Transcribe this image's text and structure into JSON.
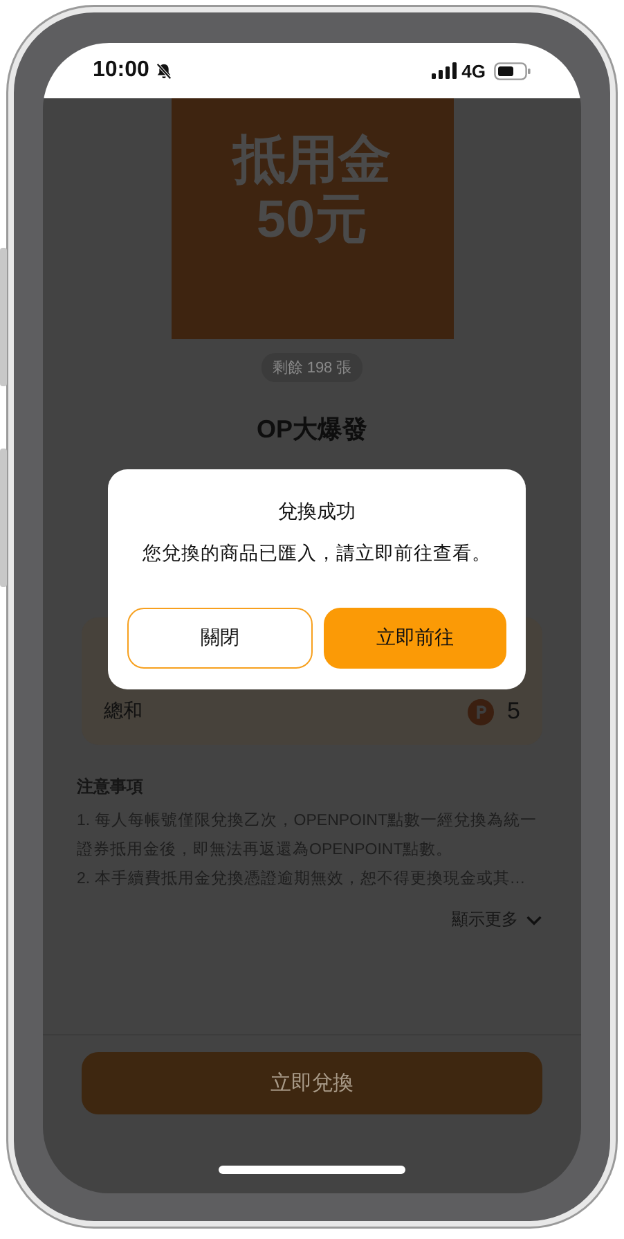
{
  "status_bar": {
    "time": "10:00",
    "silent": true,
    "network": "4G"
  },
  "coupon": {
    "lines": [
      "抵用金",
      "50元"
    ],
    "remaining": "剩餘 198 張"
  },
  "title": "OP大爆發",
  "summary": {
    "label": "總和",
    "points": "5"
  },
  "notes": {
    "title": "注意事項",
    "items": [
      "1. 每人每帳號僅限兌換乙次，OPENPOINT點數一經兌換為統一證券抵用金後，即無法再返還為OPENPOINT點數。",
      "2. 本手續費抵用金兌換憑證逾期無效，恕不得更換現金或其…"
    ],
    "show_more": "顯示更多"
  },
  "redeem_button": "立即兌換",
  "dialog": {
    "title": "兌換成功",
    "message": "您兌換的商品已匯入，請立即前往查看。",
    "buttons": [
      {
        "label": "關閉",
        "kind": "secondary"
      },
      {
        "label": "立即前往",
        "kind": "primary"
      }
    ]
  }
}
